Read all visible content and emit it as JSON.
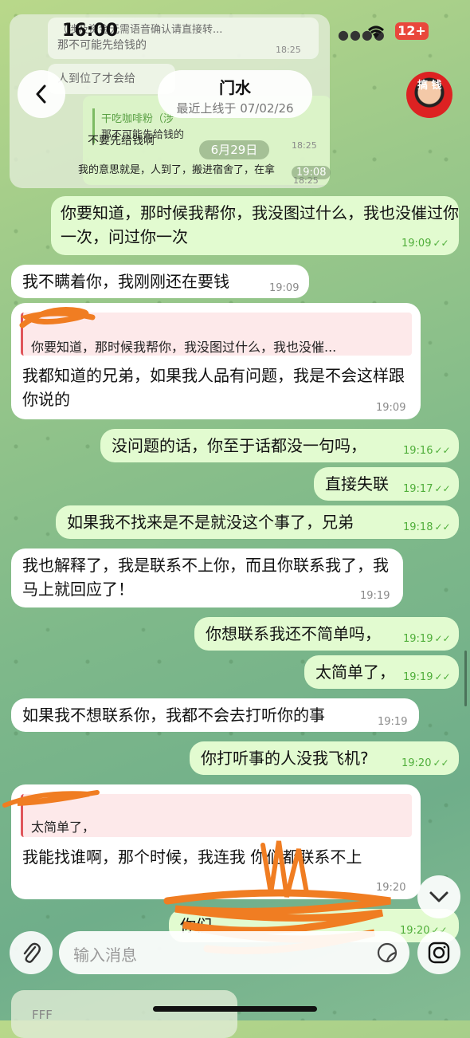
{
  "status_bar": {
    "time": "16:00",
    "battery": "12+"
  },
  "preview": {
    "line1": "（涉及资金无需语音确认请直接转...",
    "line1_time": "18:25",
    "line2": "那不可能先给钱的",
    "line3": "人到位了才会给",
    "quote_name": "干吃咖啡粉（涉",
    "quote_text": "那不可能先给钱的",
    "line4": "不要先给钱啊",
    "line4_time": "18:25",
    "line5": "我的意思就是，人到了，搬进宿舍了，在拿",
    "line5_time": "18:25"
  },
  "header": {
    "title": "门水",
    "subtitle": "最近上线于 07/02/26",
    "avatar_text": "搞 钱",
    "date_chip": "6月29日",
    "date_chip_time": "19:08"
  },
  "messages": [
    {
      "dir": "out",
      "text": "你要知道，那时候我帮你，我没图过什么，我也没催过你一次，问过你一次",
      "time": "19:09"
    },
    {
      "dir": "in",
      "text": "我不瞒着你，我刚刚还在要钱",
      "time": "19:09"
    },
    {
      "dir": "in",
      "quote": "你要知道，那时候我帮你，我没图过什么，我也没催...",
      "text": "我都知道的兄弟，如果我人品有问题，我是不会这样跟你说的",
      "time": "19:09"
    },
    {
      "dir": "out",
      "text": "没问题的话，你至于话都没一句吗，",
      "time": "19:16"
    },
    {
      "dir": "out",
      "text": "直接失联",
      "time": "19:17"
    },
    {
      "dir": "out",
      "text": "如果我不找来是不是就没这个事了，兄弟",
      "time": "19:18"
    },
    {
      "dir": "in",
      "text": "我也解释了，我是联系不上你，而且你联系我了，我马上就回应了！",
      "time": "19:19"
    },
    {
      "dir": "out",
      "text": "你想联系我还不简单吗，",
      "time": "19:19"
    },
    {
      "dir": "out",
      "text": "太简单了，",
      "time": "19:19"
    },
    {
      "dir": "in",
      "text": "如果我不想联系你，我都不会去打听你的事",
      "time": "19:19"
    },
    {
      "dir": "out",
      "text": "你打听事的人没我飞机?",
      "time": "19:20"
    },
    {
      "dir": "in",
      "quote": "太简单了，",
      "text": "我能找谁啊，那个时候，我连我 你们都联系不上",
      "time": "19:20"
    },
    {
      "dir": "out",
      "text": "你们",
      "time": "19:20"
    }
  ],
  "composer": {
    "placeholder": "输入消息"
  },
  "bottom_peek": {
    "text": "FFF"
  },
  "icons": {
    "back": "chevron-left-icon",
    "attach": "paperclip-icon",
    "sticker": "sticker-icon",
    "camera": "camera-icon",
    "scroll_down": "chevron-down-icon"
  }
}
